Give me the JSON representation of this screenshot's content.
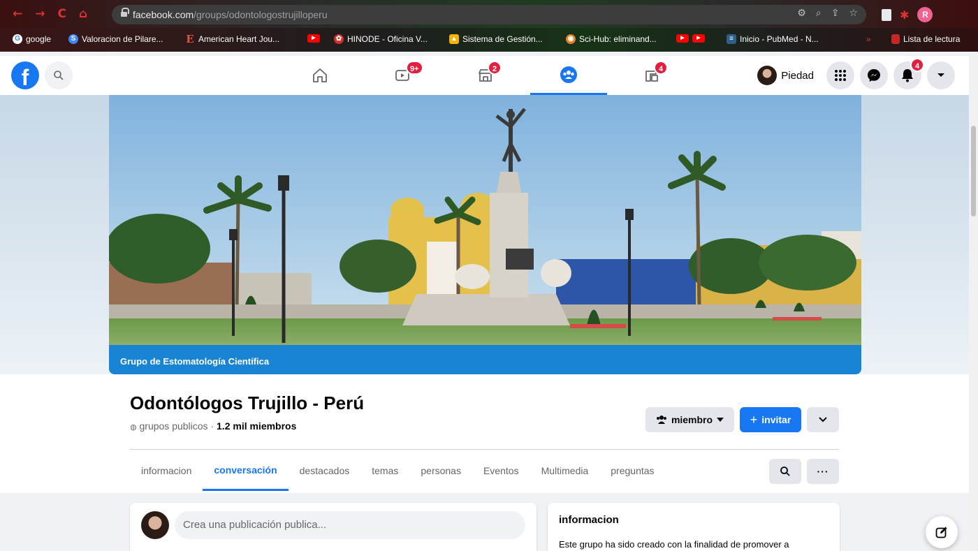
{
  "browser": {
    "url_main": "facebook.com",
    "url_path": "/groups/odontologostrujilloperu",
    "bookmarks": [
      {
        "label": "google",
        "icon": "google-icon",
        "color": "#ffffff"
      },
      {
        "label": "Valoracion de Pilare...",
        "icon": "s-icon",
        "color": "#4285f4"
      },
      {
        "label": "American Heart Jou...",
        "icon": "e-icon",
        "color": "#c0392b"
      },
      {
        "label": "",
        "icon": "youtube-icon",
        "color": "#ff0000"
      },
      {
        "label": "HINODE - Oficina V...",
        "icon": "hinode-icon",
        "color": "#d32f2f"
      },
      {
        "label": "Sistema de Gestión...",
        "icon": "chart-icon",
        "color": "#f5b400"
      },
      {
        "label": "Sci-Hub: eliminand...",
        "icon": "scihub-icon",
        "color": "#e67e22"
      },
      {
        "label": "",
        "icon": "youtube-icon",
        "color": "#ff0000"
      },
      {
        "label": "Inicio - PubMed - N...",
        "icon": "pubmed-icon",
        "color": "#2c5f8a"
      }
    ],
    "reading_list": "Lista de lectura",
    "profile_initial": "R"
  },
  "fb_header": {
    "nav": [
      {
        "name": "home",
        "badge": ""
      },
      {
        "name": "watch",
        "badge": "9+"
      },
      {
        "name": "marketplace",
        "badge": "2"
      },
      {
        "name": "groups",
        "badge": ""
      },
      {
        "name": "gaming",
        "badge": "4"
      }
    ],
    "profile_name": "Piedad",
    "notifications_badge": "4",
    "accent": "#1877f2"
  },
  "cover": {
    "caption": "Grupo de Estomatología Científica",
    "caption_color": "#1a84d4"
  },
  "group": {
    "title": "Odontólogos Trujillo - Perú",
    "privacy": "grupos publicos",
    "separator": " · ",
    "members": "1.2 mil miembros",
    "member_button": "miembro",
    "invite_button": "invitar"
  },
  "tabs": [
    {
      "label": "informacion",
      "active": false
    },
    {
      "label": "conversación",
      "active": true
    },
    {
      "label": "destacados",
      "active": false
    },
    {
      "label": "temas",
      "active": false
    },
    {
      "label": "personas",
      "active": false
    },
    {
      "label": "Eventos",
      "active": false
    },
    {
      "label": "Multimedia",
      "active": false
    },
    {
      "label": "preguntas",
      "active": false
    }
  ],
  "composer": {
    "placeholder": "Crea una publicación publica..."
  },
  "about": {
    "title": "informacion",
    "text": "Este grupo ha sido creado con la finalidad de promover a"
  }
}
